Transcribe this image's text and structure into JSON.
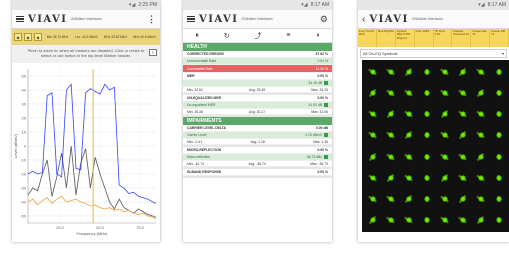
{
  "phone1": {
    "status_time": "2:25 PM",
    "logo": "VIAVI",
    "logo_sub": "ONMaker Interfaces",
    "menu_more": "⋮",
    "markers": [
      "Mkr 45.75 MHz",
      "Lev -44.6 dBmV",
      "MHz 33.63 Mkr2",
      "MHz 45.8 dBmV"
    ],
    "hint": "Pinch to zoom in; when all markers are disabled. Click or resize to select or use button in the top-level Marker header.",
    "toggle_label": "≡",
    "chart_data": {
      "type": "line",
      "xlabel": "Frequency (MHz)",
      "ylabel": "Level (dBmV)",
      "x_ticks": [
        "25.0",
        "50.0",
        "75.0"
      ],
      "y_ticks": [
        "50",
        "40",
        "30",
        "20",
        "10",
        "0",
        "-10",
        "-20",
        "-30",
        "-40",
        "-50"
      ],
      "xlim": [
        5,
        85
      ],
      "ylim": [
        -55,
        55
      ],
      "series": [
        {
          "color": "#3344ff",
          "x": [
            5,
            8,
            11,
            14,
            17,
            20,
            23,
            26,
            29,
            32,
            35,
            38,
            41,
            44,
            47,
            50,
            53,
            56,
            59,
            62,
            65,
            68,
            71,
            74,
            77,
            80,
            83,
            85
          ],
          "y": [
            -20,
            -18,
            -20,
            -19,
            36,
            38,
            -20,
            -22,
            40,
            44,
            -16,
            -17,
            38,
            41,
            39,
            37,
            44,
            40,
            42,
            -28,
            -30,
            -34,
            -33,
            -36,
            -37,
            -38,
            -40,
            -41
          ]
        },
        {
          "color": "#666666",
          "x": [
            5,
            8,
            11,
            14,
            17,
            20,
            23,
            26,
            29,
            32,
            35,
            38,
            41,
            44,
            47,
            50,
            53,
            56,
            59,
            62,
            65,
            68,
            71,
            74,
            77,
            80,
            83,
            85
          ],
          "y": [
            -35,
            -30,
            -32,
            -20,
            -10,
            -36,
            -22,
            -5,
            -30,
            0,
            -35,
            -12,
            -2,
            -30,
            -8,
            -20,
            -30,
            -40,
            -45,
            -38,
            -44,
            -46,
            -48,
            -45,
            -47,
            -49,
            -50,
            -51
          ]
        },
        {
          "color": "#f0a040",
          "x": [
            5,
            8,
            11,
            14,
            17,
            20,
            23,
            26,
            29,
            32,
            35,
            38,
            41,
            44,
            47,
            50,
            53,
            56,
            59,
            62,
            65,
            68,
            71,
            74,
            77,
            80,
            83,
            85
          ],
          "y": [
            -40,
            -38,
            -42,
            -39,
            -37,
            -41,
            -38,
            -36,
            -40,
            -39,
            -38,
            -40,
            -41,
            -43,
            -42,
            -44,
            -45,
            -44,
            -46,
            -45,
            -47,
            -46,
            -48,
            -49,
            -48,
            -50,
            -51,
            -52
          ]
        }
      ],
      "markers_x": [
        45.75
      ]
    }
  },
  "phone2": {
    "status_time": "8:17 AM",
    "logo": "VIAVI",
    "logo_sub": "ONMaker Interfaces",
    "section_health": "HEALTH",
    "row_corrected_errors": {
      "label": "CORRECTED ERRORS",
      "value": "97.82 %"
    },
    "row_uncorrectable": {
      "label": "Uncorrectable Rate",
      "value": "0.01 %"
    },
    "row_correctable": {
      "label": "Correctable Rate",
      "value": "11.00 %"
    },
    "card_mer": {
      "title": "MER",
      "value": "0.00 %",
      "sub_label": "",
      "sub_value": "34.15 dB",
      "min": "Min: 32.52",
      "avg": "Avg: 33.49",
      "max": "Max: 34.25"
    },
    "card_unequalized": {
      "title": "UN-EQUALIZED MER",
      "value": "0.00 %",
      "sub_label": "Un-equalized MER",
      "sub_value": "31.92 dB",
      "min": "Min: 26.38",
      "avg": "Avg: 30.27",
      "max": "Max: 31.66"
    },
    "section_impairments": "IMPAIRMENTS",
    "card_carrier": {
      "title": "CARRIER LEVEL DELTA",
      "value": "0.00 dB",
      "sub_label": "Carrier Level",
      "sub_value": "1.13 dBmV",
      "min": "Min: -0.41",
      "avg": "Avg: 1.18",
      "max": "Max: 1.35"
    },
    "card_micro": {
      "title": "MICRO-REFLECTION",
      "value": "0.00 %",
      "sub_label": "Micro-reflection",
      "sub_value": "-36.73 dBc",
      "min": "Min: -42.74",
      "avg": "Avg: -38.74",
      "max": "Max: -36.79"
    },
    "card_inband": {
      "title": "IN-BAND RESPONSE",
      "value": "0.00 %"
    }
  },
  "phone3": {
    "status_time": "8:17 AM",
    "logo": "VIAVI",
    "logo_sub": "ONMaker Interfaces",
    "columns": [
      "Freq 711.00 MHz",
      "Mod 64QAM",
      "Symbol Rate 5.057 MSym/s",
      "Intrlv 128/1",
      "TP Sync 5.81",
      "Packets Received 22",
      "Unique Hits 14",
      "Unique Diff 14"
    ],
    "dropdown": "All On-EQ Symbols"
  }
}
